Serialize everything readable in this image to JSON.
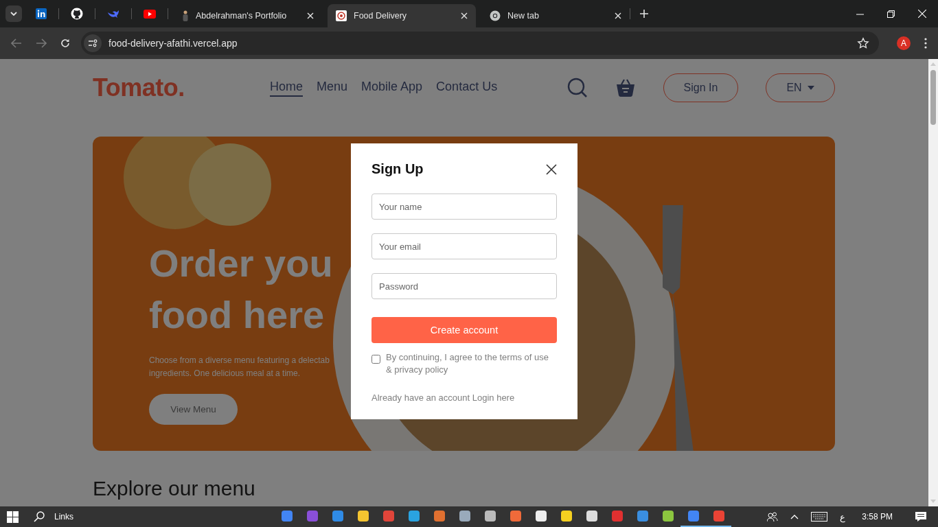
{
  "browser": {
    "tabs": [
      {
        "title": "Abdelrahman's Portfolio",
        "selected": false
      },
      {
        "title": "Food Delivery",
        "selected": true
      },
      {
        "title": "New tab",
        "selected": false
      }
    ],
    "address": "food-delivery-afathi.vercel.app",
    "profile_initial": "A"
  },
  "nav": {
    "logo": "Tomato.",
    "links": [
      {
        "label": "Home",
        "selected": true
      },
      {
        "label": "Menu",
        "selected": false
      },
      {
        "label": "Mobile App",
        "selected": false
      },
      {
        "label": "Contact Us",
        "selected": false
      }
    ],
    "sign_in": "Sign In",
    "language": "EN"
  },
  "hero": {
    "title_lines": [
      "Order you",
      "food here"
    ],
    "text_lines": [
      "Choose from a diverse menu featuring a delectab",
      "ingredients. One delicious meal at a time."
    ],
    "button": "View Menu"
  },
  "explore": {
    "heading": "Explore our menu"
  },
  "signup": {
    "title": "Sign Up",
    "fields": [
      {
        "placeholder": "Your name"
      },
      {
        "placeholder": "Your email"
      },
      {
        "placeholder": "Password"
      }
    ],
    "submit": "Create account",
    "agree_checked": false,
    "agree_text": "By continuing, I agree to the terms of use & privacy policy",
    "login_prompt": "Already have an account",
    "login_link": "Login here"
  },
  "taskbar": {
    "search_label": "Links",
    "apps": [
      {
        "open": false
      },
      {
        "open": false
      },
      {
        "open": false
      },
      {
        "open": false
      },
      {
        "open": false
      },
      {
        "open": false
      },
      {
        "open": false
      },
      {
        "open": false
      },
      {
        "open": false
      },
      {
        "open": false
      },
      {
        "open": false
      },
      {
        "open": false
      },
      {
        "open": false
      },
      {
        "open": false
      },
      {
        "open": false
      },
      {
        "open": false
      },
      {
        "open": true
      },
      {
        "open": true
      }
    ],
    "language": "ع",
    "time": "3:58 PM"
  }
}
